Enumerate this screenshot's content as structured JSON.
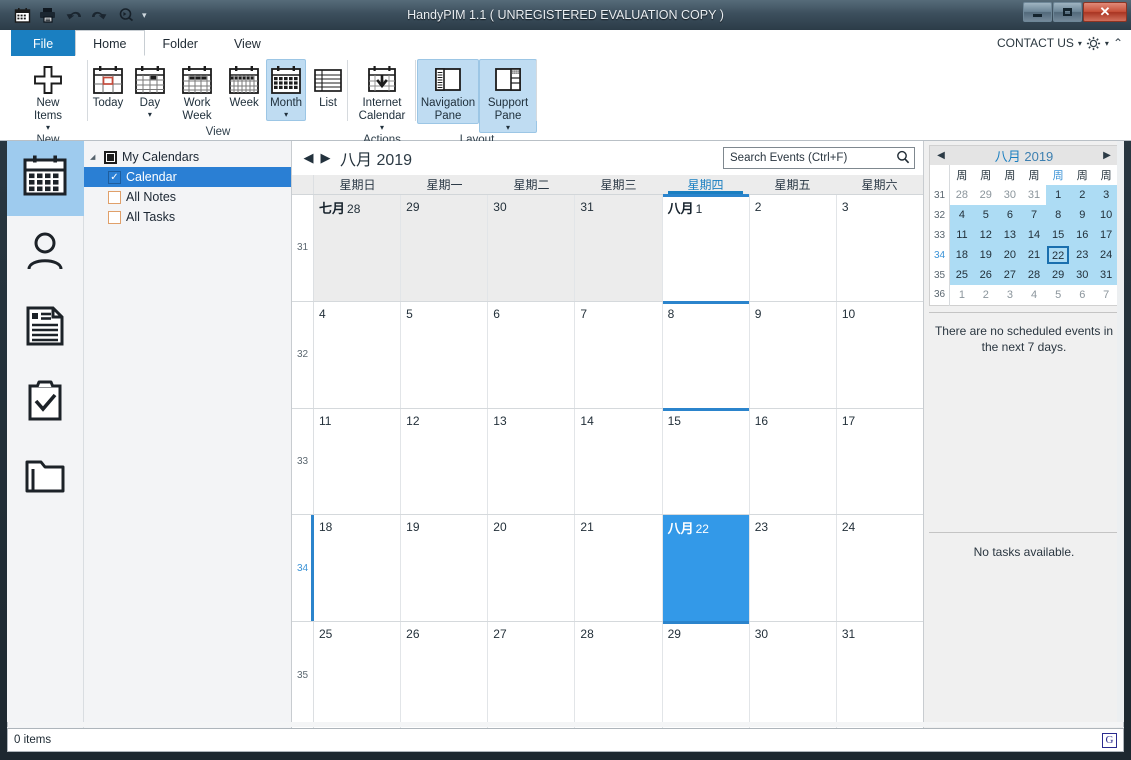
{
  "window": {
    "title": "HandyPIM 1.1 ( UNREGISTERED EVALUATION COPY )",
    "minimize_label": "",
    "maximize_label": "",
    "close_label": "✕"
  },
  "quick_access": {
    "items": [
      {
        "name": "calendar-icon",
        "label": ""
      },
      {
        "name": "print-icon",
        "label": ""
      },
      {
        "name": "undo-icon",
        "label": ""
      },
      {
        "name": "redo-icon",
        "label": ""
      },
      {
        "name": "search-icon",
        "label": ""
      }
    ],
    "overflow_label": "▾"
  },
  "tabs": [
    {
      "id": "file",
      "label": "File"
    },
    {
      "id": "home",
      "label": "Home"
    },
    {
      "id": "folder",
      "label": "Folder"
    },
    {
      "id": "view",
      "label": "View"
    }
  ],
  "header_right": {
    "contact_label": "CONTACT US",
    "dropdown_caret": "▾",
    "gear_caret": "▾",
    "collapse_caret": "⌃"
  },
  "ribbon": {
    "groups": [
      {
        "id": "new",
        "label": "New",
        "buttons": [
          {
            "id": "new-items",
            "label": "New\nItems",
            "icon": "plus-icon",
            "dropdown": true,
            "selected": false
          }
        ]
      },
      {
        "id": "view",
        "label": "View",
        "buttons": [
          {
            "id": "today",
            "label": "Today",
            "icon": "calendar-today-icon",
            "dropdown": false,
            "selected": false
          },
          {
            "id": "day",
            "label": "Day",
            "icon": "calendar-day-icon",
            "dropdown": true,
            "selected": false
          },
          {
            "id": "work-week",
            "label": "Work\nWeek",
            "icon": "calendar-workweek-icon",
            "dropdown": false,
            "selected": false
          },
          {
            "id": "week",
            "label": "Week",
            "icon": "calendar-week-icon",
            "dropdown": false,
            "selected": false
          },
          {
            "id": "month",
            "label": "Month",
            "icon": "calendar-month-icon",
            "dropdown": true,
            "selected": true
          },
          {
            "id": "list",
            "label": "List",
            "icon": "list-icon",
            "dropdown": false,
            "selected": false
          }
        ]
      },
      {
        "id": "actions",
        "label": "Actions",
        "buttons": [
          {
            "id": "internet-calendar",
            "label": "Internet\nCalendar",
            "icon": "calendar-download-icon",
            "dropdown": true,
            "selected": false
          }
        ]
      },
      {
        "id": "layout",
        "label": "Layout",
        "buttons": [
          {
            "id": "navigation-pane",
            "label": "Navigation\nPane",
            "icon": "nav-pane-icon",
            "dropdown": false,
            "selected": true
          },
          {
            "id": "support-pane",
            "label": "Support\nPane",
            "icon": "support-pane-icon",
            "dropdown": true,
            "selected": true
          }
        ]
      }
    ]
  },
  "nav_rail": [
    {
      "id": "calendar",
      "icon": "calendar-icon",
      "active": true
    },
    {
      "id": "contacts",
      "icon": "person-icon",
      "active": false
    },
    {
      "id": "notes",
      "icon": "note-icon",
      "active": false
    },
    {
      "id": "tasks",
      "icon": "clipboard-check-icon",
      "active": false
    },
    {
      "id": "folders",
      "icon": "folder-icon",
      "active": false
    }
  ],
  "tree": {
    "root": {
      "label": "My Calendars",
      "caret": "◢"
    },
    "items": [
      {
        "label": "Calendar",
        "checked": true,
        "selected": true,
        "box": "checked"
      },
      {
        "label": "All Notes",
        "checked": false,
        "selected": false,
        "box": "orange"
      },
      {
        "label": "All Tasks",
        "checked": false,
        "selected": false,
        "box": "orange"
      }
    ]
  },
  "calendar_header": {
    "prev_label": "◀",
    "next_label": "▶",
    "month_label": "八月",
    "year_label": "2019"
  },
  "search": {
    "placeholder": "Search Events (Ctrl+F)",
    "value": ""
  },
  "grid": {
    "day_headers": [
      {
        "label": "星期日",
        "highlight": false
      },
      {
        "label": "星期一",
        "highlight": false
      },
      {
        "label": "星期二",
        "highlight": false
      },
      {
        "label": "星期三",
        "highlight": false
      },
      {
        "label": "星期四",
        "highlight": true
      },
      {
        "label": "星期五",
        "highlight": false
      },
      {
        "label": "星期六",
        "highlight": false
      }
    ],
    "weeks": [
      {
        "week_number": "31",
        "current": false,
        "days": [
          {
            "num": "28",
            "month_prefix": "七月",
            "other_month": true,
            "selected": false,
            "today_col": false
          },
          {
            "num": "29",
            "month_prefix": "",
            "other_month": true,
            "selected": false,
            "today_col": false
          },
          {
            "num": "30",
            "month_prefix": "",
            "other_month": true,
            "selected": false,
            "today_col": false
          },
          {
            "num": "31",
            "month_prefix": "",
            "other_month": true,
            "selected": false,
            "today_col": false
          },
          {
            "num": "1",
            "month_prefix": "八月",
            "other_month": false,
            "selected": false,
            "today_col": true
          },
          {
            "num": "2",
            "month_prefix": "",
            "other_month": false,
            "selected": false,
            "today_col": false
          },
          {
            "num": "3",
            "month_prefix": "",
            "other_month": false,
            "selected": false,
            "today_col": false
          }
        ]
      },
      {
        "week_number": "32",
        "current": false,
        "days": [
          {
            "num": "4",
            "month_prefix": "",
            "other_month": false,
            "selected": false,
            "today_col": false
          },
          {
            "num": "5",
            "month_prefix": "",
            "other_month": false,
            "selected": false,
            "today_col": false
          },
          {
            "num": "6",
            "month_prefix": "",
            "other_month": false,
            "selected": false,
            "today_col": false
          },
          {
            "num": "7",
            "month_prefix": "",
            "other_month": false,
            "selected": false,
            "today_col": false
          },
          {
            "num": "8",
            "month_prefix": "",
            "other_month": false,
            "selected": false,
            "today_col": true
          },
          {
            "num": "9",
            "month_prefix": "",
            "other_month": false,
            "selected": false,
            "today_col": false
          },
          {
            "num": "10",
            "month_prefix": "",
            "other_month": false,
            "selected": false,
            "today_col": false
          }
        ]
      },
      {
        "week_number": "33",
        "current": false,
        "days": [
          {
            "num": "11",
            "month_prefix": "",
            "other_month": false,
            "selected": false,
            "today_col": false
          },
          {
            "num": "12",
            "month_prefix": "",
            "other_month": false,
            "selected": false,
            "today_col": false
          },
          {
            "num": "13",
            "month_prefix": "",
            "other_month": false,
            "selected": false,
            "today_col": false
          },
          {
            "num": "14",
            "month_prefix": "",
            "other_month": false,
            "selected": false,
            "today_col": false
          },
          {
            "num": "15",
            "month_prefix": "",
            "other_month": false,
            "selected": false,
            "today_col": true
          },
          {
            "num": "16",
            "month_prefix": "",
            "other_month": false,
            "selected": false,
            "today_col": false
          },
          {
            "num": "17",
            "month_prefix": "",
            "other_month": false,
            "selected": false,
            "today_col": false
          }
        ]
      },
      {
        "week_number": "34",
        "current": true,
        "days": [
          {
            "num": "18",
            "month_prefix": "",
            "other_month": false,
            "selected": false,
            "today_col": false
          },
          {
            "num": "19",
            "month_prefix": "",
            "other_month": false,
            "selected": false,
            "today_col": false
          },
          {
            "num": "20",
            "month_prefix": "",
            "other_month": false,
            "selected": false,
            "today_col": false
          },
          {
            "num": "21",
            "month_prefix": "",
            "other_month": false,
            "selected": false,
            "today_col": false
          },
          {
            "num": "22",
            "month_prefix": "八月",
            "other_month": false,
            "selected": true,
            "today_col": false
          },
          {
            "num": "23",
            "month_prefix": "",
            "other_month": false,
            "selected": false,
            "today_col": false
          },
          {
            "num": "24",
            "month_prefix": "",
            "other_month": false,
            "selected": false,
            "today_col": false
          }
        ]
      },
      {
        "week_number": "35",
        "current": false,
        "days": [
          {
            "num": "25",
            "month_prefix": "",
            "other_month": false,
            "selected": false,
            "today_col": false
          },
          {
            "num": "26",
            "month_prefix": "",
            "other_month": false,
            "selected": false,
            "today_col": false
          },
          {
            "num": "27",
            "month_prefix": "",
            "other_month": false,
            "selected": false,
            "today_col": false
          },
          {
            "num": "28",
            "month_prefix": "",
            "other_month": false,
            "selected": false,
            "today_col": false
          },
          {
            "num": "29",
            "month_prefix": "",
            "other_month": false,
            "selected": false,
            "today_col": true
          },
          {
            "num": "30",
            "month_prefix": "",
            "other_month": false,
            "selected": false,
            "today_col": false
          },
          {
            "num": "31",
            "month_prefix": "",
            "other_month": false,
            "selected": false,
            "today_col": false
          }
        ]
      }
    ]
  },
  "support_pane": {
    "mini_calendar": {
      "prev_label": "◀",
      "next_label": "▶",
      "month_label": "八月",
      "year_label": "2019",
      "day_headers": [
        {
          "label": "周",
          "highlight": false
        },
        {
          "label": "周",
          "highlight": false
        },
        {
          "label": "周",
          "highlight": false
        },
        {
          "label": "周",
          "highlight": false
        },
        {
          "label": "周",
          "highlight": true
        },
        {
          "label": "周",
          "highlight": false
        },
        {
          "label": "周",
          "highlight": false
        }
      ],
      "rows": [
        {
          "week_number": "31",
          "current": false,
          "days": [
            {
              "num": "28",
              "in_month": false,
              "today": false
            },
            {
              "num": "29",
              "in_month": false,
              "today": false
            },
            {
              "num": "30",
              "in_month": false,
              "today": false
            },
            {
              "num": "31",
              "in_month": false,
              "today": false
            },
            {
              "num": "1",
              "in_month": true,
              "today": false
            },
            {
              "num": "2",
              "in_month": true,
              "today": false
            },
            {
              "num": "3",
              "in_month": true,
              "today": false
            }
          ]
        },
        {
          "week_number": "32",
          "current": false,
          "days": [
            {
              "num": "4",
              "in_month": true,
              "today": false
            },
            {
              "num": "5",
              "in_month": true,
              "today": false
            },
            {
              "num": "6",
              "in_month": true,
              "today": false
            },
            {
              "num": "7",
              "in_month": true,
              "today": false
            },
            {
              "num": "8",
              "in_month": true,
              "today": false
            },
            {
              "num": "9",
              "in_month": true,
              "today": false
            },
            {
              "num": "10",
              "in_month": true,
              "today": false
            }
          ]
        },
        {
          "week_number": "33",
          "current": false,
          "days": [
            {
              "num": "11",
              "in_month": true,
              "today": false
            },
            {
              "num": "12",
              "in_month": true,
              "today": false
            },
            {
              "num": "13",
              "in_month": true,
              "today": false
            },
            {
              "num": "14",
              "in_month": true,
              "today": false
            },
            {
              "num": "15",
              "in_month": true,
              "today": false
            },
            {
              "num": "16",
              "in_month": true,
              "today": false
            },
            {
              "num": "17",
              "in_month": true,
              "today": false
            }
          ]
        },
        {
          "week_number": "34",
          "current": true,
          "days": [
            {
              "num": "18",
              "in_month": true,
              "today": false
            },
            {
              "num": "19",
              "in_month": true,
              "today": false
            },
            {
              "num": "20",
              "in_month": true,
              "today": false
            },
            {
              "num": "21",
              "in_month": true,
              "today": false
            },
            {
              "num": "22",
              "in_month": true,
              "today": true
            },
            {
              "num": "23",
              "in_month": true,
              "today": false
            },
            {
              "num": "24",
              "in_month": true,
              "today": false
            }
          ]
        },
        {
          "week_number": "35",
          "current": false,
          "days": [
            {
              "num": "25",
              "in_month": true,
              "today": false
            },
            {
              "num": "26",
              "in_month": true,
              "today": false
            },
            {
              "num": "27",
              "in_month": true,
              "today": false
            },
            {
              "num": "28",
              "in_month": true,
              "today": false
            },
            {
              "num": "29",
              "in_month": true,
              "today": false
            },
            {
              "num": "30",
              "in_month": true,
              "today": false
            },
            {
              "num": "31",
              "in_month": true,
              "today": false
            }
          ]
        },
        {
          "week_number": "36",
          "current": false,
          "days": [
            {
              "num": "1",
              "in_month": false,
              "today": false
            },
            {
              "num": "2",
              "in_month": false,
              "today": false
            },
            {
              "num": "3",
              "in_month": false,
              "today": false
            },
            {
              "num": "4",
              "in_month": false,
              "today": false
            },
            {
              "num": "5",
              "in_month": false,
              "today": false
            },
            {
              "num": "6",
              "in_month": false,
              "today": false
            },
            {
              "num": "7",
              "in_month": false,
              "today": false
            }
          ]
        }
      ]
    },
    "events_empty_text": "There are no scheduled events in the next 7 days.",
    "tasks_empty_text": "No tasks available."
  },
  "status_bar": {
    "items_text": "0 items",
    "brand_mark": "G"
  },
  "colors": {
    "accent_blue": "#1a7fc1",
    "selection_blue": "#3399e8",
    "tree_selection": "#2a7fd4",
    "ribbon_selected": "#bfdcf2",
    "mini_inmonth": "#addcf4",
    "close_red": "#c75039"
  }
}
